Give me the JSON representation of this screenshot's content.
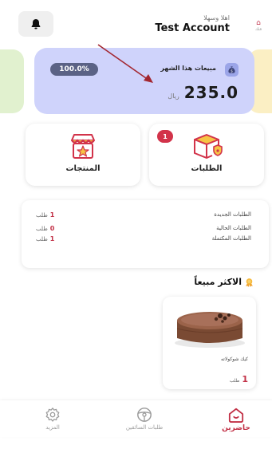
{
  "header": {
    "greeting": "اهلا وسهلا",
    "account_name": "Test Account",
    "logo_text": "فنك"
  },
  "sales": {
    "title": "مبيعات هذا الشهر",
    "percent": "100.0%",
    "amount": "235.0",
    "currency": "ريال"
  },
  "tiles": {
    "products_label": "المنتجات",
    "orders_label": "الطلبات",
    "orders_badge": "1"
  },
  "stats": [
    {
      "label": "الطلبات الجديدة",
      "count": "1",
      "unit": "طلب"
    },
    {
      "label": "الطلبات الحالية",
      "count": "0",
      "unit": "طلب"
    },
    {
      "label": "الطلبات المكتملة",
      "count": "1",
      "unit": "طلب"
    }
  ],
  "best_sellers": {
    "title": "الاكثر مبيعاً",
    "items": [
      {
        "name": "كيك شوكولاته",
        "count": "1",
        "unit": "طلب"
      }
    ]
  },
  "nav": {
    "present": "حاضرين",
    "drivers": "طلبات السائقين",
    "more": "المزيد"
  },
  "colors": {
    "accent": "#c23046",
    "sales_card": "#cfd3fb",
    "badge_dark": "#5b6285"
  },
  "icons": {
    "notifications": "bell-icon",
    "sales": "money-bag-icon",
    "products": "store-icon",
    "orders": "package-icon",
    "best_seller": "medal-icon",
    "present": "home-icon",
    "drivers": "steering-wheel-icon",
    "more": "gear-icon"
  }
}
